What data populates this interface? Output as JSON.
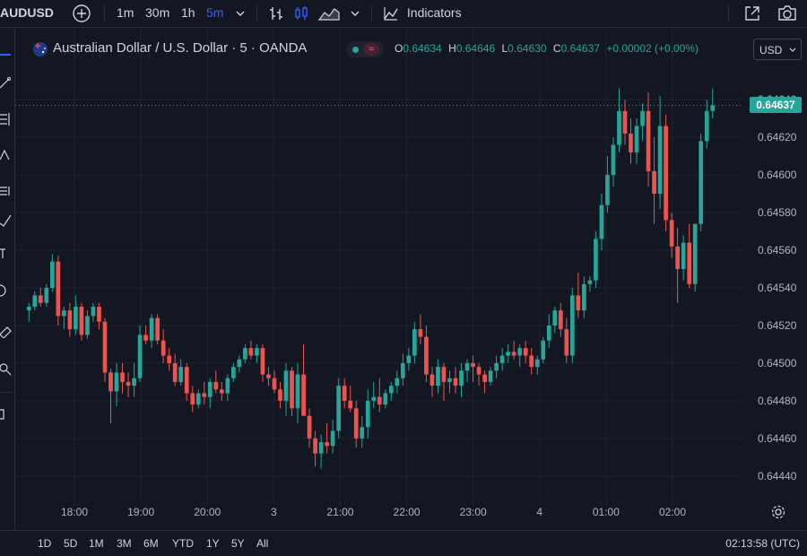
{
  "toolbar": {
    "symbol": "AUDUSD",
    "intervals": [
      "1m",
      "30m",
      "1h",
      "5m"
    ],
    "active_interval": "5m",
    "indicators_label": "Indicators"
  },
  "legend": {
    "title": "Australian Dollar / U.S. Dollar · 5 · OANDA",
    "o_label": "O",
    "o_value": "0.64634",
    "h_label": "H",
    "h_value": "0.64646",
    "l_label": "L",
    "l_value": "0.64630",
    "c_label": "C",
    "c_value": "0.64637",
    "change": "+0.00002 (+0.00%)"
  },
  "currency_button": "USD",
  "last_price": "0.64637",
  "colors": {
    "up": "#26a69a",
    "down": "#ef5350",
    "background": "#131722",
    "accent": "#2962ff"
  },
  "bottom": {
    "ranges": [
      "1D",
      "5D",
      "1M",
      "3M",
      "6M",
      "YTD",
      "1Y",
      "5Y",
      "All"
    ],
    "clock": "02:13:58 (UTC)"
  },
  "chart_data": {
    "type": "candlestick",
    "y_ticks": [
      "0.64640",
      "0.64620",
      "0.64600",
      "0.64580",
      "0.64560",
      "0.64540",
      "0.64520",
      "0.64500",
      "0.64480",
      "0.64460",
      "0.64440"
    ],
    "x_ticks": [
      "18:00",
      "19:00",
      "20:00",
      "3",
      "21:00",
      "22:00",
      "23:00",
      "4",
      "01:00",
      "02:00"
    ],
    "ylim": [
      0.64428,
      0.64652
    ],
    "last_price": 0.64637,
    "candles": [
      [
        0.64528,
        0.64532,
        0.64522,
        0.6453
      ],
      [
        0.6453,
        0.64538,
        0.64528,
        0.64536
      ],
      [
        0.64536,
        0.6454,
        0.6453,
        0.64532
      ],
      [
        0.64532,
        0.64542,
        0.6453,
        0.6454
      ],
      [
        0.6454,
        0.64558,
        0.64538,
        0.64554
      ],
      [
        0.64554,
        0.64557,
        0.6452,
        0.64525
      ],
      [
        0.64525,
        0.6453,
        0.64518,
        0.64528
      ],
      [
        0.64528,
        0.64532,
        0.64514,
        0.64518
      ],
      [
        0.64518,
        0.64536,
        0.64515,
        0.6453
      ],
      [
        0.6453,
        0.64532,
        0.64512,
        0.64515
      ],
      [
        0.64515,
        0.64528,
        0.64513,
        0.64525
      ],
      [
        0.64525,
        0.64532,
        0.64522,
        0.6453
      ],
      [
        0.6453,
        0.64532,
        0.64518,
        0.64522
      ],
      [
        0.64522,
        0.64524,
        0.6449,
        0.64495
      ],
      [
        0.64495,
        0.64497,
        0.64468,
        0.64485
      ],
      [
        0.64485,
        0.645,
        0.64477,
        0.64495
      ],
      [
        0.64495,
        0.645,
        0.64484,
        0.6449
      ],
      [
        0.6449,
        0.64495,
        0.64482,
        0.64488
      ],
      [
        0.64488,
        0.645,
        0.64482,
        0.64492
      ],
      [
        0.64492,
        0.6452,
        0.6449,
        0.64515
      ],
      [
        0.64515,
        0.6452,
        0.6451,
        0.64512
      ],
      [
        0.64512,
        0.64526,
        0.64508,
        0.64524
      ],
      [
        0.64524,
        0.64526,
        0.6451,
        0.64512
      ],
      [
        0.64512,
        0.64518,
        0.645,
        0.64504
      ],
      [
        0.64504,
        0.64508,
        0.64496,
        0.645
      ],
      [
        0.645,
        0.64505,
        0.64488,
        0.6449
      ],
      [
        0.6449,
        0.64502,
        0.64488,
        0.64498
      ],
      [
        0.64498,
        0.645,
        0.6448,
        0.64484
      ],
      [
        0.64484,
        0.64488,
        0.64474,
        0.64478
      ],
      [
        0.64478,
        0.64486,
        0.64476,
        0.64484
      ],
      [
        0.64484,
        0.6449,
        0.64478,
        0.64482
      ],
      [
        0.64482,
        0.64492,
        0.64476,
        0.6449
      ],
      [
        0.6449,
        0.64496,
        0.64484,
        0.64486
      ],
      [
        0.64486,
        0.6449,
        0.6448,
        0.64484
      ],
      [
        0.64484,
        0.64494,
        0.6448,
        0.64492
      ],
      [
        0.64492,
        0.645,
        0.6449,
        0.64498
      ],
      [
        0.64498,
        0.64504,
        0.64495,
        0.64502
      ],
      [
        0.64502,
        0.6451,
        0.645,
        0.64508
      ],
      [
        0.64508,
        0.64512,
        0.64502,
        0.64504
      ],
      [
        0.64504,
        0.6451,
        0.645,
        0.64508
      ],
      [
        0.64508,
        0.6451,
        0.6449,
        0.64494
      ],
      [
        0.64494,
        0.64498,
        0.64488,
        0.64492
      ],
      [
        0.64492,
        0.64496,
        0.64484,
        0.64486
      ],
      [
        0.64486,
        0.6449,
        0.64476,
        0.6448
      ],
      [
        0.6448,
        0.645,
        0.64472,
        0.64496
      ],
      [
        0.64496,
        0.64498,
        0.64472,
        0.64476
      ],
      [
        0.64476,
        0.645,
        0.64468,
        0.64494
      ],
      [
        0.64494,
        0.6451,
        0.6449,
        0.64472
      ],
      [
        0.64472,
        0.64476,
        0.64455,
        0.6446
      ],
      [
        0.6446,
        0.64464,
        0.64445,
        0.64452
      ],
      [
        0.64452,
        0.64462,
        0.64444,
        0.64458
      ],
      [
        0.64458,
        0.64468,
        0.64452,
        0.64456
      ],
      [
        0.64456,
        0.6447,
        0.64452,
        0.64464
      ],
      [
        0.64464,
        0.64492,
        0.6446,
        0.64488
      ],
      [
        0.64488,
        0.64492,
        0.64476,
        0.6448
      ],
      [
        0.6448,
        0.64488,
        0.64474,
        0.64476
      ],
      [
        0.64476,
        0.6448,
        0.64455,
        0.6446
      ],
      [
        0.6446,
        0.64472,
        0.64455,
        0.64466
      ],
      [
        0.64466,
        0.64486,
        0.6446,
        0.6448
      ],
      [
        0.6448,
        0.6449,
        0.64476,
        0.64482
      ],
      [
        0.64482,
        0.64492,
        0.64474,
        0.64478
      ],
      [
        0.64478,
        0.64486,
        0.64476,
        0.64484
      ],
      [
        0.64484,
        0.6449,
        0.6448,
        0.64488
      ],
      [
        0.64488,
        0.64496,
        0.64484,
        0.64492
      ],
      [
        0.64492,
        0.64505,
        0.64488,
        0.645
      ],
      [
        0.645,
        0.64508,
        0.64496,
        0.64504
      ],
      [
        0.64504,
        0.64522,
        0.645,
        0.64518
      ],
      [
        0.64518,
        0.64526,
        0.6451,
        0.64514
      ],
      [
        0.64514,
        0.6452,
        0.6449,
        0.64494
      ],
      [
        0.64494,
        0.64498,
        0.64482,
        0.64488
      ],
      [
        0.64488,
        0.64502,
        0.64484,
        0.64498
      ],
      [
        0.64498,
        0.645,
        0.6448,
        0.6449
      ],
      [
        0.6449,
        0.64496,
        0.64484,
        0.64492
      ],
      [
        0.64492,
        0.64498,
        0.64484,
        0.64488
      ],
      [
        0.64488,
        0.645,
        0.64482,
        0.64496
      ],
      [
        0.64496,
        0.64502,
        0.6449,
        0.645
      ],
      [
        0.645,
        0.64504,
        0.6449,
        0.64498
      ],
      [
        0.64498,
        0.645,
        0.64488,
        0.64494
      ],
      [
        0.64494,
        0.64496,
        0.64484,
        0.6449
      ],
      [
        0.6449,
        0.64498,
        0.64488,
        0.64496
      ],
      [
        0.64496,
        0.64504,
        0.64492,
        0.645
      ],
      [
        0.645,
        0.64508,
        0.64496,
        0.64504
      ],
      [
        0.64504,
        0.6451,
        0.645,
        0.64506
      ],
      [
        0.64506,
        0.64512,
        0.64502,
        0.64504
      ],
      [
        0.64504,
        0.6451,
        0.64498,
        0.64508
      ],
      [
        0.64508,
        0.64512,
        0.645,
        0.64504
      ],
      [
        0.64504,
        0.64508,
        0.64494,
        0.64498
      ],
      [
        0.64498,
        0.64504,
        0.64494,
        0.64502
      ],
      [
        0.64502,
        0.64514,
        0.645,
        0.64512
      ],
      [
        0.64512,
        0.64526,
        0.64508,
        0.6452
      ],
      [
        0.6452,
        0.6453,
        0.64516,
        0.64528
      ],
      [
        0.64528,
        0.64532,
        0.64514,
        0.64518
      ],
      [
        0.64518,
        0.64524,
        0.645,
        0.64504
      ],
      [
        0.64504,
        0.6454,
        0.645,
        0.64536
      ],
      [
        0.64536,
        0.64548,
        0.64524,
        0.64528
      ],
      [
        0.64528,
        0.64546,
        0.64524,
        0.64542
      ],
      [
        0.64542,
        0.64546,
        0.64538,
        0.64544
      ],
      [
        0.64544,
        0.6457,
        0.6454,
        0.64566
      ],
      [
        0.64566,
        0.6459,
        0.6456,
        0.64584
      ],
      [
        0.64584,
        0.6461,
        0.6458,
        0.646
      ],
      [
        0.646,
        0.6462,
        0.64594,
        0.64616
      ],
      [
        0.64616,
        0.64646,
        0.64612,
        0.64634
      ],
      [
        0.64634,
        0.6464,
        0.64616,
        0.64622
      ],
      [
        0.64622,
        0.6463,
        0.64606,
        0.64612
      ],
      [
        0.64612,
        0.6463,
        0.64606,
        0.64626
      ],
      [
        0.64626,
        0.64638,
        0.64618,
        0.64634
      ],
      [
        0.64634,
        0.64644,
        0.64594,
        0.64602
      ],
      [
        0.64602,
        0.6462,
        0.64574,
        0.6459
      ],
      [
        0.6459,
        0.64642,
        0.64582,
        0.64626
      ],
      [
        0.64626,
        0.64632,
        0.6457,
        0.64576
      ],
      [
        0.64576,
        0.6458,
        0.64556,
        0.64562
      ],
      [
        0.64562,
        0.64572,
        0.64532,
        0.6455
      ],
      [
        0.6455,
        0.64568,
        0.64544,
        0.64564
      ],
      [
        0.64564,
        0.64574,
        0.6454,
        0.64542
      ],
      [
        0.64542,
        0.64574,
        0.64538,
        0.64574
      ],
      [
        0.64574,
        0.64622,
        0.6457,
        0.64618
      ],
      [
        0.64618,
        0.6464,
        0.64614,
        0.64634
      ],
      [
        0.64634,
        0.64646,
        0.6463,
        0.64637
      ]
    ]
  }
}
